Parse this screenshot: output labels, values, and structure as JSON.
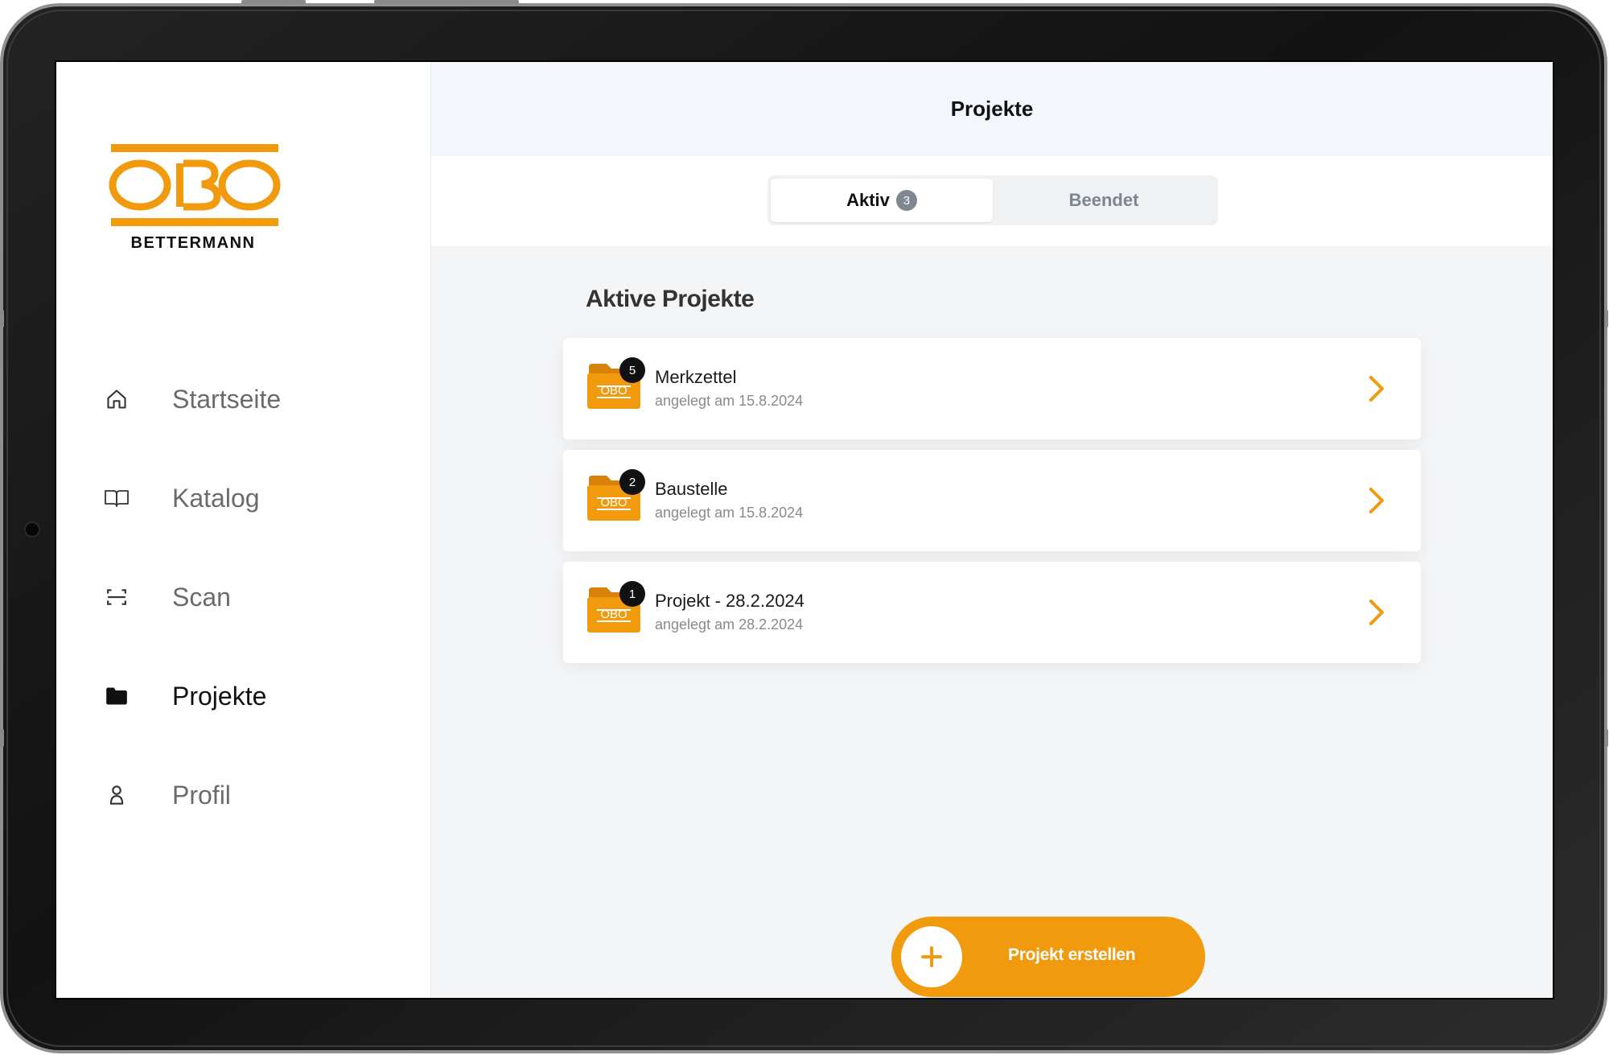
{
  "brand": {
    "logo_text": "OBO",
    "logo_subtitle": "BETTERMANN",
    "accent_color": "#f29a0e"
  },
  "sidebar": {
    "items": [
      {
        "label": "Startseite",
        "icon": "home-icon"
      },
      {
        "label": "Katalog",
        "icon": "book-icon"
      },
      {
        "label": "Scan",
        "icon": "scan-icon"
      },
      {
        "label": "Projekte",
        "icon": "folder-icon",
        "active": true
      },
      {
        "label": "Profil",
        "icon": "person-icon"
      }
    ]
  },
  "header": {
    "title": "Projekte"
  },
  "tabs": {
    "active": {
      "label": "Aktiv",
      "count": "3"
    },
    "ended": {
      "label": "Beendet"
    }
  },
  "section": {
    "title": "Aktive Projekte"
  },
  "projects": [
    {
      "name": "Merkzettel",
      "date": "angelegt am 15.8.2024",
      "count": "5",
      "icon": "obo-folder-icon"
    },
    {
      "name": "Baustelle",
      "date": "angelegt am 15.8.2024",
      "count": "2",
      "icon": "obo-folder-icon"
    },
    {
      "name": "Projekt - 28.2.2024",
      "date": "angelegt am 28.2.2024",
      "count": "1",
      "icon": "obo-folder-icon"
    }
  ],
  "create_button": {
    "label": "Projekt erstellen",
    "icon": "plus-icon"
  }
}
